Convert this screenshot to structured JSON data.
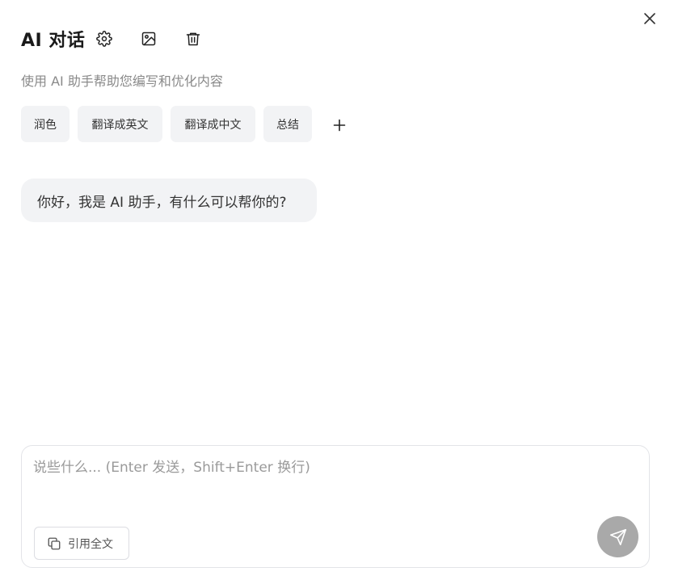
{
  "header": {
    "title": "AI 对话",
    "icons": [
      "gear-icon",
      "image-icon",
      "trash-icon"
    ],
    "close_icon": "close-icon"
  },
  "subtitle": "使用 AI 助手帮助您编写和优化内容",
  "chips": [
    {
      "label": "润色"
    },
    {
      "label": "翻译成英文"
    },
    {
      "label": "翻译成中文"
    },
    {
      "label": "总结"
    }
  ],
  "add_chip_icon": "plus-icon",
  "messages": [
    {
      "role": "assistant",
      "text": "你好，我是 AI 助手，有什么可以帮你的?"
    }
  ],
  "composer": {
    "placeholder": "说些什么... (Enter 发送，Shift+Enter 换行)",
    "value": "",
    "quote_label": "引用全文",
    "send_icon": "send-icon"
  },
  "colors": {
    "chip_bg": "#f2f3f5",
    "send_bg": "#a9a9a9",
    "muted_text": "#8a8a8a"
  }
}
